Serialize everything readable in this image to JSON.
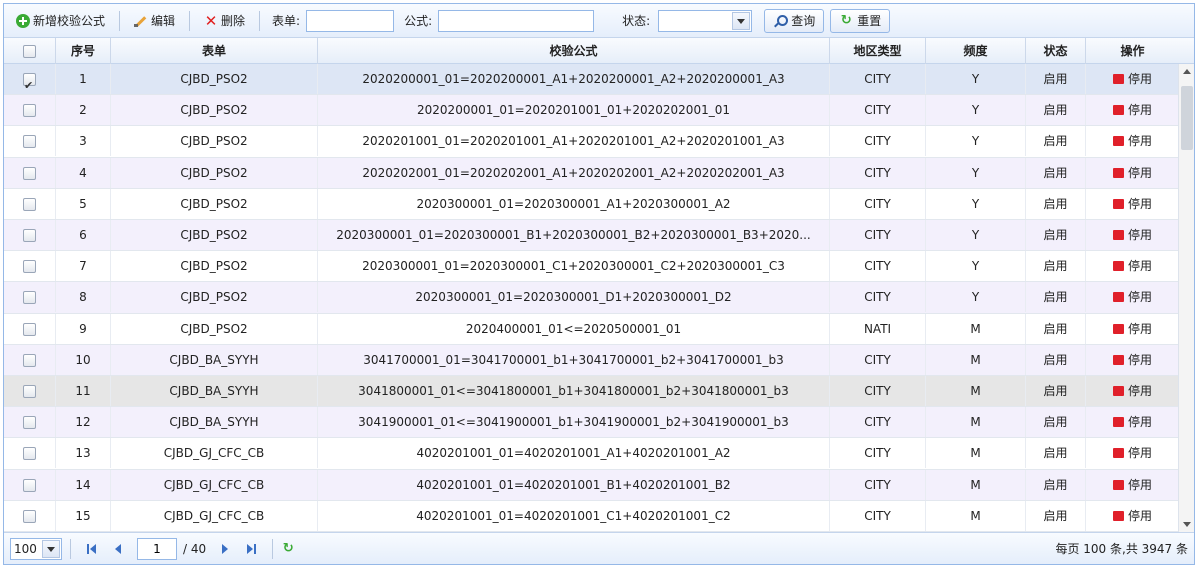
{
  "toolbar": {
    "add_label": "新增校验公式",
    "edit_label": "编辑",
    "delete_label": "删除",
    "form_label": "表单:",
    "form_value": "",
    "formula_label": "公式:",
    "formula_value": "",
    "status_label": "状态:",
    "status_value": "",
    "search_label": "查询",
    "reset_label": "重置"
  },
  "columns": [
    "序号",
    "表单",
    "校验公式",
    "地区类型",
    "频度",
    "状态",
    "操作"
  ],
  "stop_label": "停用",
  "rows": [
    {
      "no": "1",
      "form": "CJBD_PSO2",
      "formula": "2020200001_01=2020200001_A1+2020200001_A2+2020200001_A3",
      "region": "CITY",
      "freq": "Y",
      "status": "启用",
      "checked": true
    },
    {
      "no": "2",
      "form": "CJBD_PSO2",
      "formula": "2020200001_01=2020201001_01+2020202001_01",
      "region": "CITY",
      "freq": "Y",
      "status": "启用",
      "checked": false
    },
    {
      "no": "3",
      "form": "CJBD_PSO2",
      "formula": "2020201001_01=2020201001_A1+2020201001_A2+2020201001_A3",
      "region": "CITY",
      "freq": "Y",
      "status": "启用",
      "checked": false
    },
    {
      "no": "4",
      "form": "CJBD_PSO2",
      "formula": "2020202001_01=2020202001_A1+2020202001_A2+2020202001_A3",
      "region": "CITY",
      "freq": "Y",
      "status": "启用",
      "checked": false
    },
    {
      "no": "5",
      "form": "CJBD_PSO2",
      "formula": "2020300001_01=2020300001_A1+2020300001_A2",
      "region": "CITY",
      "freq": "Y",
      "status": "启用",
      "checked": false
    },
    {
      "no": "6",
      "form": "CJBD_PSO2",
      "formula": "2020300001_01=2020300001_B1+2020300001_B2+2020300001_B3+2020...",
      "region": "CITY",
      "freq": "Y",
      "status": "启用",
      "checked": false
    },
    {
      "no": "7",
      "form": "CJBD_PSO2",
      "formula": "2020300001_01=2020300001_C1+2020300001_C2+2020300001_C3",
      "region": "CITY",
      "freq": "Y",
      "status": "启用",
      "checked": false
    },
    {
      "no": "8",
      "form": "CJBD_PSO2",
      "formula": "2020300001_01=2020300001_D1+2020300001_D2",
      "region": "CITY",
      "freq": "Y",
      "status": "启用",
      "checked": false
    },
    {
      "no": "9",
      "form": "CJBD_PSO2",
      "formula": "2020400001_01<=2020500001_01",
      "region": "NATI",
      "freq": "M",
      "status": "启用",
      "checked": false
    },
    {
      "no": "10",
      "form": "CJBD_BA_SYYH",
      "formula": "3041700001_01=3041700001_b1+3041700001_b2+3041700001_b3",
      "region": "CITY",
      "freq": "M",
      "status": "启用",
      "checked": false
    },
    {
      "no": "11",
      "form": "CJBD_BA_SYYH",
      "formula": "3041800001_01<=3041800001_b1+3041800001_b2+3041800001_b3",
      "region": "CITY",
      "freq": "M",
      "status": "启用",
      "checked": false
    },
    {
      "no": "12",
      "form": "CJBD_BA_SYYH",
      "formula": "3041900001_01<=3041900001_b1+3041900001_b2+3041900001_b3",
      "region": "CITY",
      "freq": "M",
      "status": "启用",
      "checked": false
    },
    {
      "no": "13",
      "form": "CJBD_GJ_CFC_CB",
      "formula": "4020201001_01=4020201001_A1+4020201001_A2",
      "region": "CITY",
      "freq": "M",
      "status": "启用",
      "checked": false
    },
    {
      "no": "14",
      "form": "CJBD_GJ_CFC_CB",
      "formula": "4020201001_01=4020201001_B1+4020201001_B2",
      "region": "CITY",
      "freq": "M",
      "status": "启用",
      "checked": false
    },
    {
      "no": "15",
      "form": "CJBD_GJ_CFC_CB",
      "formula": "4020201001_01=4020201001_C1+4020201001_C2",
      "region": "CITY",
      "freq": "M",
      "status": "启用",
      "checked": false
    }
  ],
  "pager": {
    "page_size": "100",
    "page_number": "1",
    "total_pages": "/ 40",
    "info": "每页 100 条,共 3947 条"
  },
  "colors": {
    "accent": "#95b8e7",
    "stop": "#e0202a",
    "add": "#3aaa35"
  }
}
